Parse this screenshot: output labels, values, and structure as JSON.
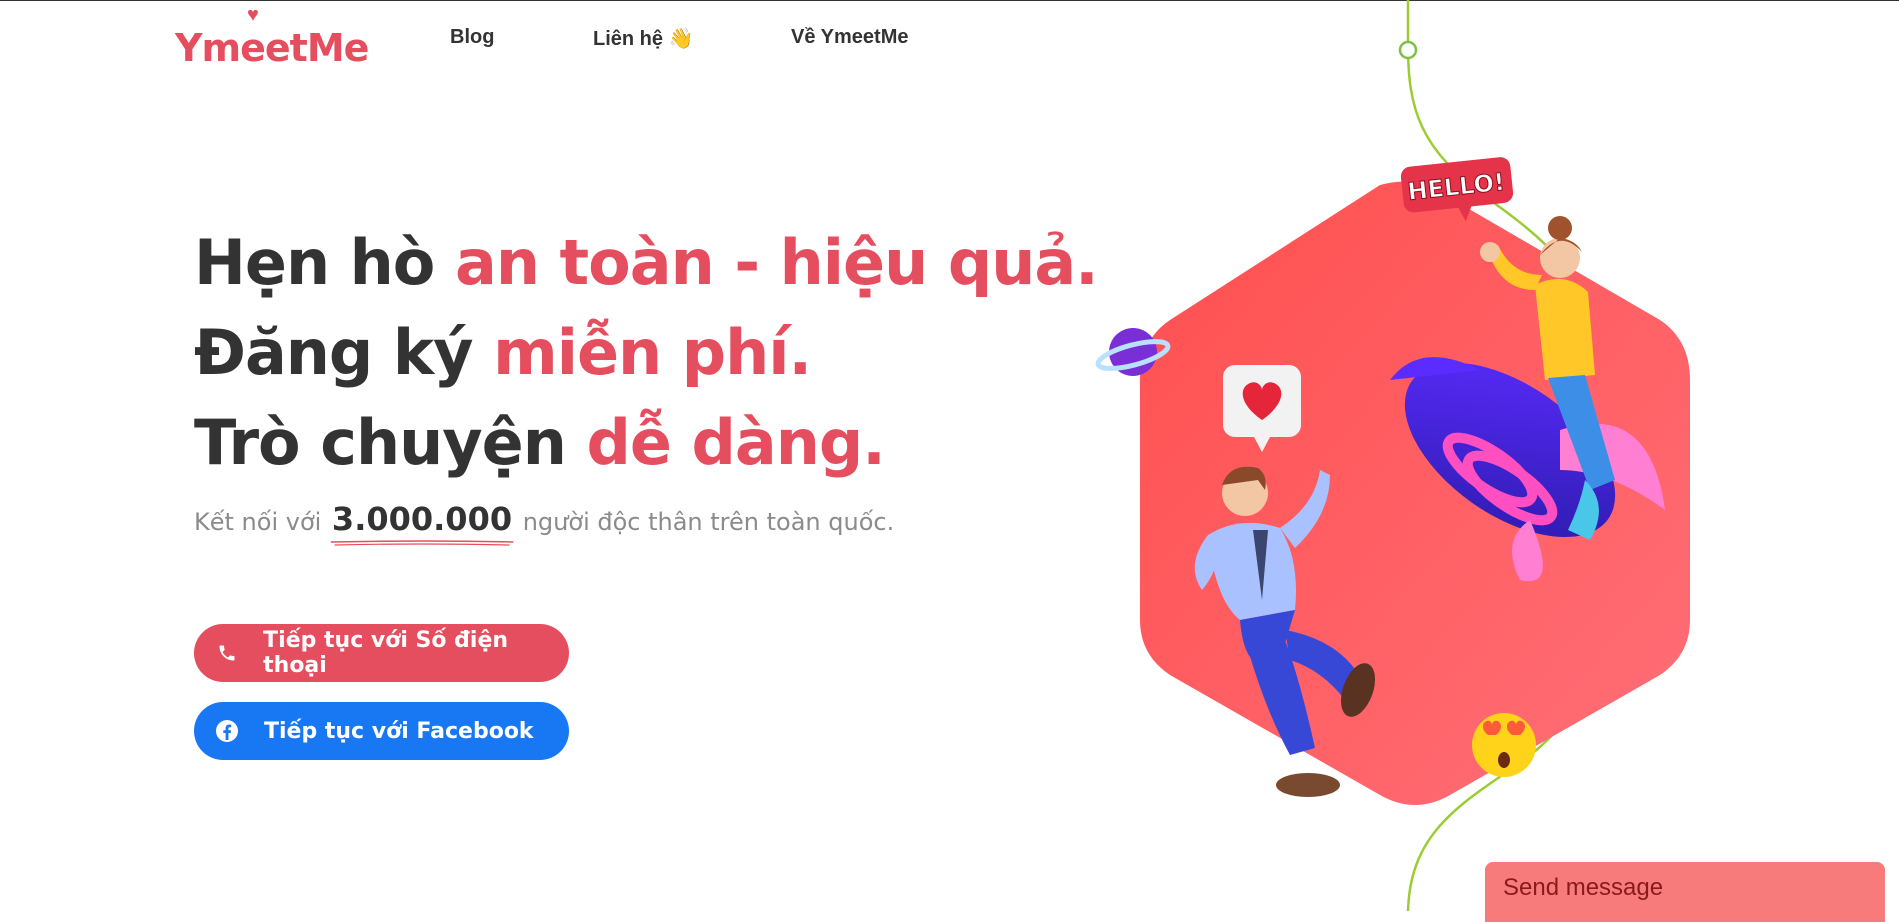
{
  "brand": {
    "logo_text": "YmeetMe",
    "accent_color": "#e54e5e",
    "facebook_color": "#1877f2"
  },
  "nav": {
    "items": [
      {
        "label": "Blog"
      },
      {
        "label": "Liên hệ 👋"
      },
      {
        "label": "Về YmeetMe"
      }
    ]
  },
  "hero": {
    "line1": {
      "plain": "Hẹn hò ",
      "accent": "an toàn - hiệu quả."
    },
    "line2": {
      "plain": "Đăng ký ",
      "accent": "miễn phí."
    },
    "line3": {
      "plain": "Trò chuyện ",
      "accent": "dễ dàng."
    },
    "sub_prefix": "Kết nối với ",
    "sub_count": "3.000.000",
    "sub_suffix": " người độc thân trên toàn quốc."
  },
  "buttons": {
    "phone_label": "Tiếp tục với Số điện thoại",
    "facebook_label": "Tiếp tục với Facebook"
  },
  "illustration": {
    "hello_text": "HELLO!"
  },
  "widget": {
    "send_message_label": "Send message"
  }
}
